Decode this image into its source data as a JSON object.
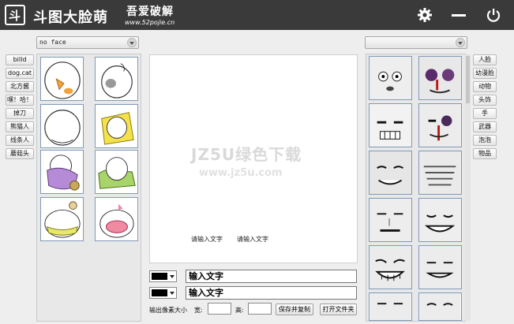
{
  "header": {
    "logo_char": "斗",
    "title": "斗图大脸萌",
    "brand_top": "吾爱破解",
    "brand_url": "www.52pojie.cn",
    "icons": [
      "gear-icon",
      "minimize-icon",
      "power-icon"
    ]
  },
  "left_combo": {
    "value": "no face"
  },
  "right_combo": {
    "value": ""
  },
  "left_categories": [
    "billd",
    "dog.cat",
    "北方酱",
    "嘿！哈！",
    "掉刀",
    "熊猫人",
    "线条人",
    "蘑菇头"
  ],
  "right_categories": [
    "人脸",
    "幼漫脸",
    "动物",
    "头饰",
    "手",
    "武器",
    "泡泡",
    "物品"
  ],
  "canvas": {
    "watermark_main": "JZ5U绿色下载",
    "watermark_url": "www.jz5u.com",
    "placeholder_1": "请输入文字",
    "placeholder_2": "请输入文字"
  },
  "text_inputs": [
    {
      "value": "输入文字",
      "color": "#000000"
    },
    {
      "value": "输入文字",
      "color": "#000000"
    }
  ],
  "bottom": {
    "size_label": "输出像素大小",
    "width_label": "宽:",
    "height_label": "高:",
    "width_value": "",
    "height_value": "",
    "save_copy": "保存并复制",
    "open_folder": "打开文件夹"
  },
  "colors": {
    "titlebar": "#3a3a3a",
    "thumb_border": "#7f9ab9"
  }
}
